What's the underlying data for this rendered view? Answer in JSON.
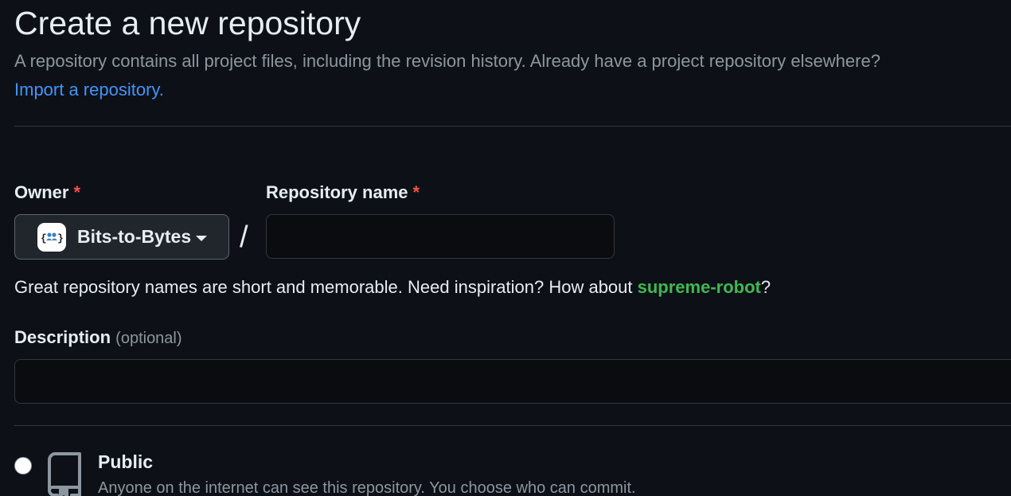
{
  "header": {
    "title": "Create a new repository",
    "subtitle": "A repository contains all project files, including the revision history. Already have a project repository elsewhere?",
    "import_link": "Import a repository."
  },
  "owner": {
    "label": "Owner",
    "required_mark": "*",
    "selected": "Bits-to-Bytes",
    "avatar_text": "{👥}",
    "icon": "chevron-down-icon"
  },
  "separator": "/",
  "repo_name": {
    "label": "Repository name",
    "required_mark": "*",
    "value": ""
  },
  "hint": {
    "prefix": "Great repository names are short and memorable. Need inspiration? How about ",
    "suggestion": "supreme-robot",
    "suffix": "?"
  },
  "description": {
    "label": "Description",
    "optional": "(optional)",
    "value": ""
  },
  "visibility": {
    "public_title": "Public",
    "public_desc": "Anyone on the internet can see this repository. You choose who can commit.",
    "icon": "repo-icon"
  },
  "colors": {
    "background": "#0d1117",
    "link": "#4493f8",
    "required": "#f85149",
    "suggestion": "#3fb950"
  }
}
